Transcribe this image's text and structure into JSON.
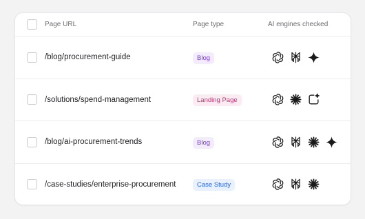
{
  "table": {
    "columns": {
      "url": "Page URL",
      "type": "Page type",
      "engines": "AI engines checked"
    },
    "rows": [
      {
        "url": "/blog/procurement-guide",
        "page_type": "Blog",
        "badge_bg": "#f3ecfd",
        "badge_color": "#7c3aed",
        "engines": [
          "openai-icon",
          "perplexity-icon",
          "gemini-icon"
        ]
      },
      {
        "url": "/solutions/spend-management",
        "page_type": "Landing Page",
        "badge_bg": "#fdebf3",
        "badge_color": "#db2777",
        "engines": [
          "openai-icon",
          "claude-icon",
          "copilot-icon"
        ]
      },
      {
        "url": "/blog/ai-procurement-trends",
        "page_type": "Blog",
        "badge_bg": "#f3ecfd",
        "badge_color": "#7c3aed",
        "engines": [
          "openai-icon",
          "perplexity-icon",
          "claude-icon",
          "gemini-icon"
        ]
      },
      {
        "url": "/case-studies/enterprise-procurement",
        "page_type": "Case Study",
        "badge_bg": "#e9f1fd",
        "badge_color": "#2563eb",
        "engines": [
          "openai-icon",
          "perplexity-icon",
          "claude-icon"
        ]
      }
    ]
  }
}
